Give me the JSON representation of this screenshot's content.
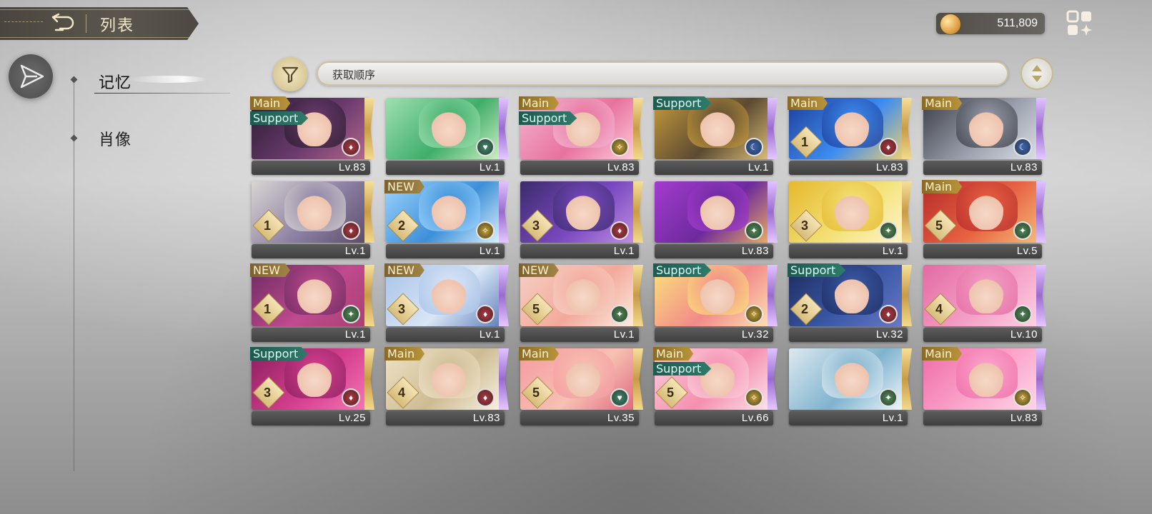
{
  "header": {
    "title": "列表"
  },
  "currency": {
    "amount": "511,809",
    "icon": "gold-coin-icon"
  },
  "nav": {
    "items": [
      {
        "label": "记忆",
        "active": true
      },
      {
        "label": "肖像",
        "active": false
      }
    ]
  },
  "toolbar": {
    "sort_label": "获取顺序"
  },
  "colors": {
    "accent_gold": "#c9a95b",
    "tag_main": "#b8943a",
    "tag_support": "#2f7a6b",
    "tag_new": "#a18547"
  },
  "cards": [
    {
      "level": "Lv.83",
      "tags": [
        "Main",
        "Support"
      ],
      "rank": "",
      "palette": "dark-purple",
      "attribute": "fire"
    },
    {
      "level": "Lv.1",
      "tags": [],
      "rank": "",
      "palette": "green",
      "attribute": "heart"
    },
    {
      "level": "Lv.83",
      "tags": [
        "Main",
        "Support"
      ],
      "rank": "",
      "palette": "pink",
      "attribute": "light"
    },
    {
      "level": "Lv.1",
      "tags": [
        "Support"
      ],
      "rank": "",
      "palette": "gold-brown",
      "attribute": "water"
    },
    {
      "level": "Lv.83",
      "tags": [
        "Main"
      ],
      "rank": "1",
      "palette": "blue",
      "attribute": "fire"
    },
    {
      "level": "Lv.83",
      "tags": [
        "Main"
      ],
      "rank": "",
      "palette": "dark-silver",
      "attribute": "water"
    },
    {
      "level": "Lv.1",
      "tags": [],
      "rank": "1",
      "palette": "silver-purple",
      "attribute": "fire"
    },
    {
      "level": "Lv.1",
      "tags": [
        "NEW"
      ],
      "rank": "2",
      "palette": "sky-blue",
      "attribute": "light"
    },
    {
      "level": "Lv.1",
      "tags": [],
      "rank": "3",
      "palette": "violet",
      "attribute": "fire"
    },
    {
      "level": "Lv.83",
      "tags": [],
      "rank": "",
      "palette": "magenta",
      "attribute": "wind"
    },
    {
      "level": "Lv.1",
      "tags": [],
      "rank": "3",
      "palette": "yellow",
      "attribute": "wind"
    },
    {
      "level": "Lv.5",
      "tags": [
        "Main"
      ],
      "rank": "5",
      "palette": "red",
      "attribute": "wind"
    },
    {
      "level": "Lv.1",
      "tags": [
        "NEW"
      ],
      "rank": "1",
      "palette": "crimson-purple",
      "attribute": "wind"
    },
    {
      "level": "Lv.1",
      "tags": [
        "NEW"
      ],
      "rank": "3",
      "palette": "ice",
      "attribute": "fire"
    },
    {
      "level": "Lv.1",
      "tags": [
        "NEW"
      ],
      "rank": "5",
      "palette": "peach",
      "attribute": "wind"
    },
    {
      "level": "Lv.32",
      "tags": [
        "Support"
      ],
      "rank": "",
      "palette": "sunny",
      "attribute": "light"
    },
    {
      "level": "Lv.32",
      "tags": [
        "Support"
      ],
      "rank": "2",
      "palette": "navy",
      "attribute": "fire"
    },
    {
      "level": "Lv.10",
      "tags": [],
      "rank": "4",
      "palette": "rose",
      "attribute": "wind"
    },
    {
      "level": "Lv.25",
      "tags": [
        "Support"
      ],
      "rank": "3",
      "palette": "berry",
      "attribute": "fire"
    },
    {
      "level": "Lv.83",
      "tags": [
        "Main"
      ],
      "rank": "4",
      "palette": "cream",
      "attribute": "fire"
    },
    {
      "level": "Lv.35",
      "tags": [
        "Main"
      ],
      "rank": "5",
      "palette": "coral",
      "attribute": "heart"
    },
    {
      "level": "Lv.66",
      "tags": [
        "Main",
        "Support"
      ],
      "rank": "5",
      "palette": "pink-light",
      "attribute": "light"
    },
    {
      "level": "Lv.1",
      "tags": [],
      "rank": "",
      "palette": "teal-white",
      "attribute": "wind"
    },
    {
      "level": "Lv.83",
      "tags": [
        "Main"
      ],
      "rank": "",
      "palette": "hot-pink",
      "attribute": "light"
    }
  ]
}
